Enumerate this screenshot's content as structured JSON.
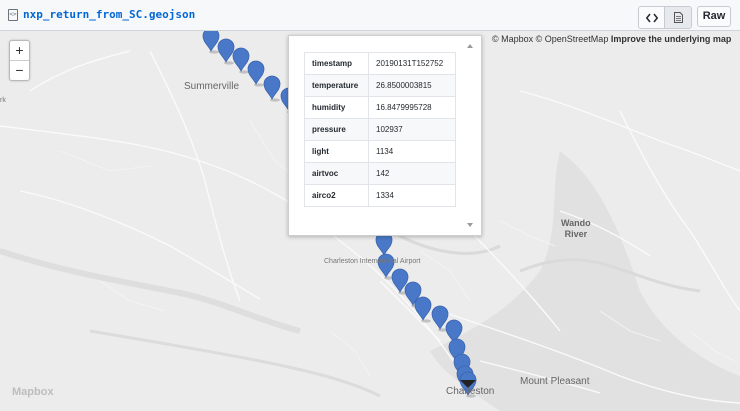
{
  "header": {
    "file_icon": "code-file-icon",
    "file_icon_glyph": "<>",
    "file_name": "nxp_return_from_SC.geojson",
    "raw_label": "Raw",
    "code_view_icon": "code-icon",
    "rendered_view_icon": "document-icon"
  },
  "map": {
    "zoom_in": "+",
    "zoom_out": "−",
    "attribution_prefix": "© Mapbox © OpenStreetMap",
    "attribution_link": "Improve the underlying map",
    "logo": "Mapbox",
    "labels": {
      "summerville": "Summerville",
      "airport": "Charleston International Airport",
      "wando_line1": "Wando",
      "wando_line2": "River",
      "mount_pleasant": "Mount Pleasant",
      "charleston": "Charleston",
      "left_edge": "rk"
    },
    "marker_color": "#4a78c9",
    "marker_icon": "map-pin-icon"
  },
  "popup": {
    "rows": [
      {
        "key": "timestamp",
        "value": "20190131T152752"
      },
      {
        "key": "temperature",
        "value": "26.8500003815"
      },
      {
        "key": "humidity",
        "value": "16.8479995728"
      },
      {
        "key": "pressure",
        "value": "102937"
      },
      {
        "key": "light",
        "value": "1134"
      },
      {
        "key": "airtvoc",
        "value": "142"
      },
      {
        "key": "airco2",
        "value": "1334"
      }
    ]
  }
}
